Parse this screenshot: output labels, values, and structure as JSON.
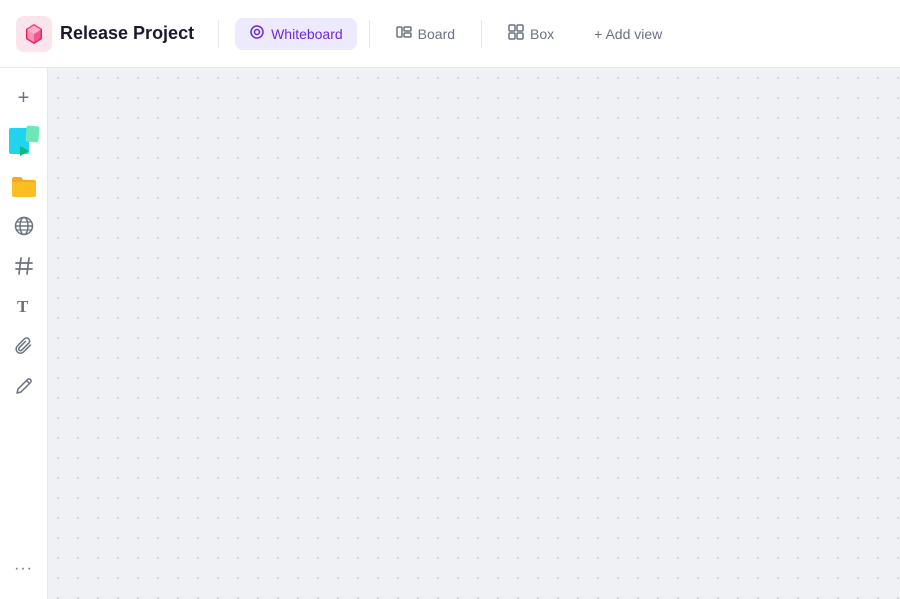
{
  "header": {
    "project_icon_alt": "cube-icon",
    "project_title": "Release Project",
    "tabs": [
      {
        "id": "whiteboard",
        "label": "Whiteboard",
        "icon": "◎",
        "active": true
      },
      {
        "id": "board",
        "label": "Board",
        "icon": "⊞",
        "active": false
      },
      {
        "id": "box",
        "label": "Box",
        "icon": "⊟",
        "active": false
      }
    ],
    "add_view_label": "+ Add view"
  },
  "sidebar": {
    "items": [
      {
        "id": "add",
        "icon": "+",
        "label": "add"
      },
      {
        "id": "sticky",
        "icon": "sticky",
        "label": "sticky-notes"
      },
      {
        "id": "folder",
        "icon": "folder",
        "label": "folder"
      },
      {
        "id": "globe",
        "icon": "🌐",
        "label": "globe"
      },
      {
        "id": "hashtag",
        "icon": "#",
        "label": "hashtag"
      },
      {
        "id": "text",
        "icon": "T",
        "label": "text"
      },
      {
        "id": "paperclip",
        "icon": "🖇",
        "label": "paperclip"
      },
      {
        "id": "pen",
        "icon": "✏",
        "label": "pen"
      }
    ],
    "more_label": "..."
  }
}
